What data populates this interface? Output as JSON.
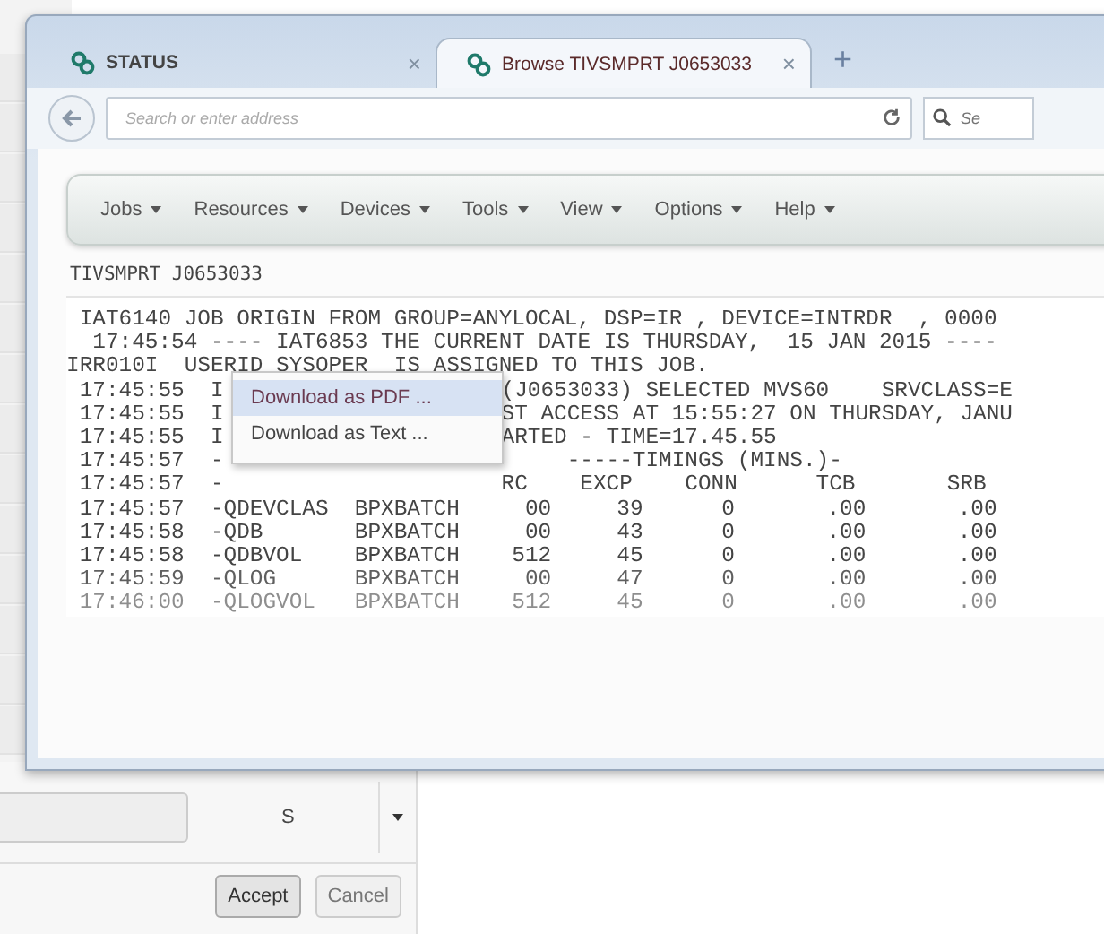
{
  "tabs": [
    {
      "label": "STATUS",
      "selected": false,
      "close": "×"
    },
    {
      "label": "Browse TIVSMPRT J0653033",
      "selected": true,
      "close": "×"
    }
  ],
  "new_tab": "+",
  "address": {
    "placeholder": "Search or enter address"
  },
  "search": {
    "placeholder": "Se"
  },
  "menu": [
    "Jobs",
    "Resources",
    "Devices",
    "Tools",
    "View",
    "Options",
    "Help"
  ],
  "job_title": "TIVSMPRT J0653033",
  "log": [
    {
      "text": " IAT6140 JOB ORIGIN FROM GROUP=ANYLOCAL, DSP=IR , DEVICE=INTRDR  , 0000"
    },
    {
      "text": "  17:45:54 ---- IAT6853 THE CURRENT DATE IS THURSDAY,  15 JAN 2015 ----"
    },
    {
      "text": "IRR010I  USERID SYSOPER  IS ASSIGNED TO THIS JOB."
    },
    {
      "text": " 17:45:55  I",
      "after": "(J0653033) SELECTED MVS60    SRVCLASS=E"
    },
    {
      "text": " 17:45:55  I",
      "after": "ST ACCESS AT 15:55:27 ON THURSDAY, JANU"
    },
    {
      "text": " 17:45:55  I",
      "after": "ARTED - TIME=17.45.55"
    },
    {
      "text": " 17:45:57  -",
      "after": "     -----TIMINGS (MINS.)-"
    },
    {
      "text": " 17:45:57  -",
      "after": "RC    EXCP    CONN      TCB       SRB"
    },
    {
      "text": " 17:45:57  -QDEVCLAS  BPXBATCH     00     39      0       .00       .00"
    },
    {
      "text": " 17:45:58  -QDB       BPXBATCH     00     43      0       .00       .00"
    },
    {
      "text": " 17:45:58  -QDBVOL    BPXBATCH    512     45      0       .00       .00"
    },
    {
      "text": " 17:45:59  -QLOG      BPXBATCH     00     47      0       .00       .00"
    },
    {
      "text": " 17:46:00  -QLOGVOL   BPXBATCH    512     45      0       .00       .00"
    }
  ],
  "context_menu": [
    {
      "label": "Download as PDF ...",
      "selected": true
    },
    {
      "label": "Download as Text ...",
      "selected": false
    }
  ],
  "dialog": {
    "value": "S",
    "buttons": [
      {
        "label": "Accept",
        "selected": true
      },
      {
        "label": "Cancel",
        "selected": false
      }
    ]
  }
}
